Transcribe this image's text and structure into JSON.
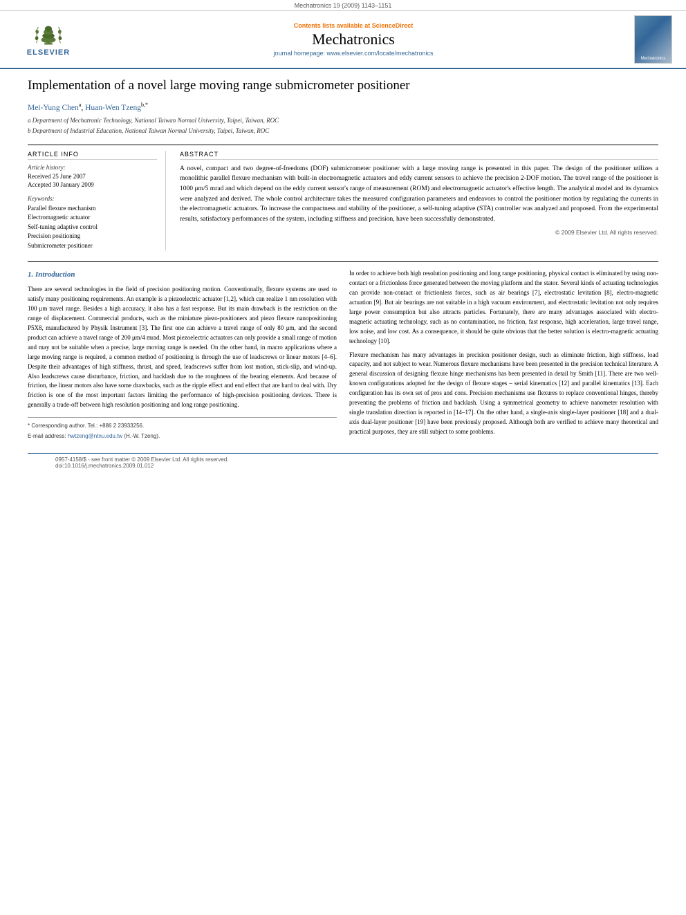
{
  "journal": {
    "top_bar": "Mechatronics 19 (2009) 1143–1151",
    "sciencedirect_text": "Contents lists available at ",
    "sciencedirect_link": "ScienceDirect",
    "title": "Mechatronics",
    "homepage_prefix": "journal homepage: ",
    "homepage_url": "www.elsevier.com/locate/mechatronics",
    "elsevier_label": "ELSEVIER",
    "cover_title": "Mechatronics"
  },
  "article": {
    "title": "Implementation of a novel large moving range submicrometer positioner",
    "authors": "Mei-Yung Chen a, Huan-Wen Tzeng b,*",
    "affiliation_a": "a Department of Mechatronic Technology, National Taiwan Normal University, Taipei, Taiwan, ROC",
    "affiliation_b": "b Department of Industrial Education, National Taiwan Normal University, Taipei, Taiwan, ROC"
  },
  "article_info": {
    "section_label": "Article Info",
    "history_label": "Article history:",
    "received": "Received 25 June 2007",
    "accepted": "Accepted 30 January 2009",
    "keywords_label": "Keywords:",
    "kw1": "Parallel flexure mechanism",
    "kw2": "Electromagnetic actuator",
    "kw3": "Self-tuning adaptive control",
    "kw4": "Precision positioning",
    "kw5": "Submicrometer positioner"
  },
  "abstract": {
    "section_label": "Abstract",
    "text": "A novel, compact and two degree-of-freedoms (DOF) submicrometer positioner with a large moving range is presented in this paper. The design of the positioner utilizes a monolithic parallel flexure mechanism with built-in electromagnetic actuators and eddy current sensors to achieve the precision 2-DOF motion. The travel range of the positioner is 1000 μm/5 mrad and which depend on the eddy current sensor's range of measurement (ROM) and electromagnetic actuator's effective length. The analytical model and its dynamics were analyzed and derived. The whole control architecture takes the measured configuration parameters and endeavors to control the positioner motion by regulating the currents in the electromagnetic actuators. To increase the compactness and stability of the positioner, a self-tuning adaptive (STA) controller was analyzed and proposed. From the experimental results, satisfactory performances of the system, including stiffness and precision, have been successfully demonstrated.",
    "copyright": "© 2009 Elsevier Ltd. All rights reserved."
  },
  "section1": {
    "heading": "1. Introduction",
    "para1": "There are several technologies in the field of precision positioning motion. Conventionally, flexure systems are used to satisfy many positioning requirements. An example is a piezoelectric actuator [1,2], which can realize 1 nm resolution with 100 μm travel range. Besides a high accuracy, it also has a fast response. But its main drawback is the restriction on the range of displacement. Commercial products, such as the miniature piezo-positioners and piezo flexure nanopositioning P5X8, manufactured by Physik Instrument [3]. The first one can achieve a travel range of only 80 μm, and the second product can achieve a travel range of 200 μm/4 mrad. Most piezoelectric actuators can only provide a small range of motion and may not be suitable when a precise, large moving range is needed. On the other hand, in macro applications where a large moving range is required, a common method of positioning is through the use of leadscrews or linear motors [4–6]. Despite their advantages of high stiffness, thrust, and speed, leadscrews suffer from lost motion, stick-slip, and wind-up. Also leadscrews cause disturbance, friction, and backlash due to the roughness of the bearing elements. And because of friction, the linear motors also have some drawbacks, such as the ripple effect and end effect that are hard to deal with. Dry friction is one of the most important factors limiting the performance of high-precision positioning devices. There is generally a trade-off between high resolution positioning and long range positioning.",
    "para2": "In order to achieve both high resolution positioning and long range positioning, physical contact is eliminated by using non-contact or a frictionless force generated between the moving platform and the stator. Several kinds of actuating technologies can provide non-contact or frictionless forces, such as air bearings [7], electrostatic levitation [8], electro-magnetic actuation [9]. But air bearings are not suitable in a high vacuum environment, and electrostatic levitation not only requires large power consumption but also attracts particles. Fortunately, there are many advantages associated with electro-magnetic actuating technology, such as no contamination, no friction, fast response, high acceleration, large travel range, low noise, and low cost. As a consequence, it should be quite obvious that the better solution is electro-magnetic actuating technology [10].",
    "para3": "Flexure mechanism has many advantages in precision positioner design, such as eliminate friction, high stiffness, load capacity, and not subject to wear. Numerous flexure mechanisms have been presented in the precision technical literature. A general discussion of designing flexure hinge mechanisms has been presented in detail by Smith [11]. There are two well-known configurations adopted for the design of flexure stages – serial kinematics [12] and parallel kinematics [13]. Each configuration has its own set of pros and cons. Precision mechanisms use flexures to replace conventional hinges, thereby preventing the problems of friction and backlash. Using a symmetrical geometry to achieve nanometer resolution with single translation direction is reported in [14–17]. On the other hand, a single-axis single-layer positioner [18] and a dual-axis dual-layer positioner [19] have been previously proposed. Although both are verified to achieve many theoretical and practical purposes, they are still subject to some problems."
  },
  "footer": {
    "corresponding_note": "* Corresponding author. Tel.: +886 2 23933256.",
    "email_label": "E-mail address: ",
    "email": "hwtzeng@ntnu.edu.tw",
    "email_author": "(H.-W. Tzeng).",
    "issn": "0957-4158/$ - see front matter © 2009 Elsevier Ltd. All rights reserved.",
    "doi": "doi:10.1016/j.mechatronics.2009.01.012"
  }
}
